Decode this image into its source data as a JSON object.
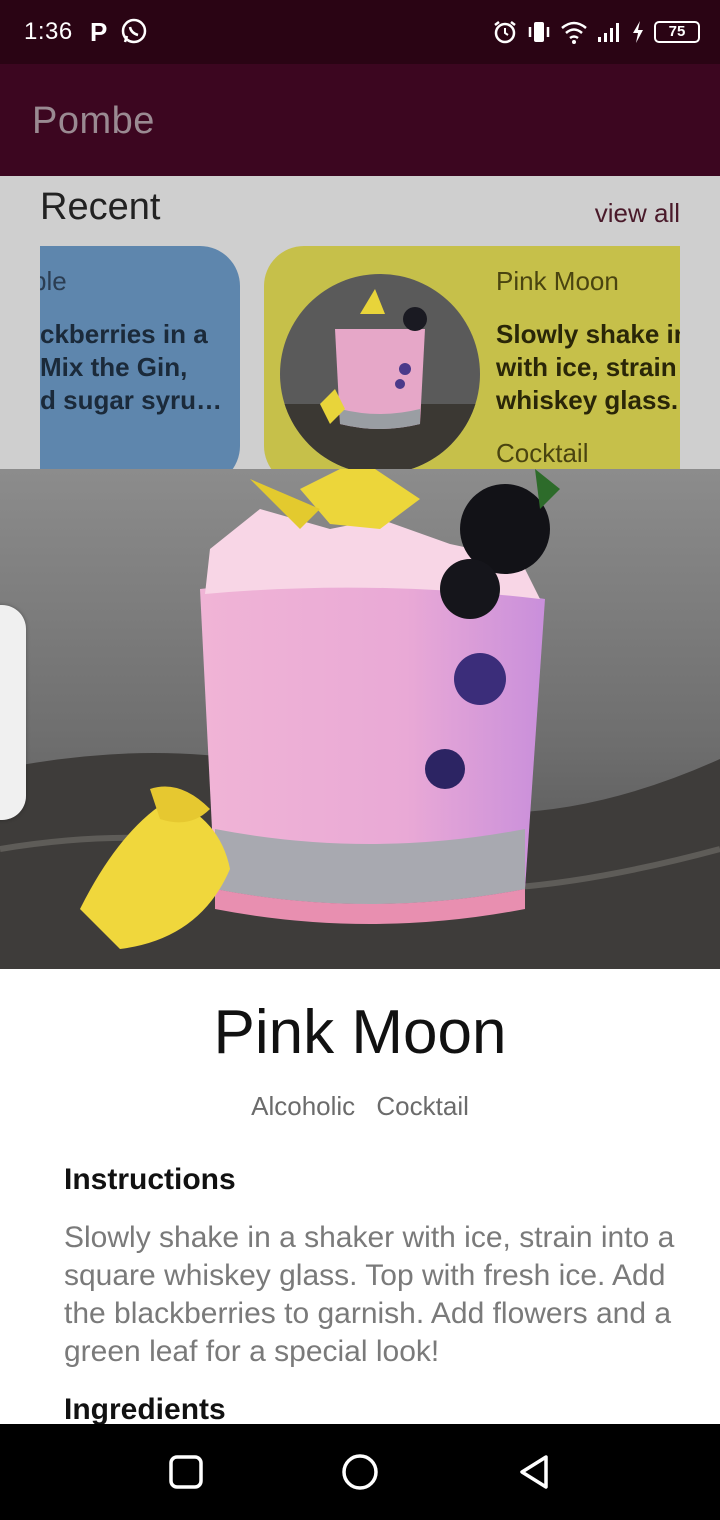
{
  "status_bar": {
    "time": "1:36",
    "p_icon": "P",
    "battery": "75",
    "icons": [
      "whatsapp-icon",
      "alarm-icon",
      "vibrate-icon",
      "wifi-icon",
      "signal-icon",
      "charging-icon",
      "battery-icon"
    ]
  },
  "app_bar": {
    "title": "Pombe"
  },
  "recent": {
    "title": "Recent",
    "view_all": "view all",
    "cards": [
      {
        "name": "ble",
        "description_lines": [
          "ckberries in a",
          "Mix the Gin,",
          "d sugar syru…"
        ],
        "color": "#5e86ad"
      },
      {
        "name": "Pink Moon",
        "description_lines": [
          "Slowly shake in",
          "with ice, strain",
          "whiskey glass."
        ],
        "category": "Cocktail",
        "color": "#c6c04a"
      }
    ]
  },
  "detail": {
    "name": "Pink Moon",
    "tags": [
      "Alcoholic",
      "Cocktail"
    ],
    "instructions_heading": "Instructions",
    "instructions": "Slowly shake in a shaker with ice, strain into a square whiskey glass. Top with fresh ice. Add the blackberries to garnish. Add flowers and a green leaf for a special look!",
    "ingredients_heading": "Ingredients"
  },
  "nav": {
    "icons": [
      "recents-icon",
      "home-icon",
      "back-icon"
    ]
  },
  "colors": {
    "status_bar": "#2a0414",
    "app_bar": "#3c0620",
    "accent": "#3c0620"
  }
}
